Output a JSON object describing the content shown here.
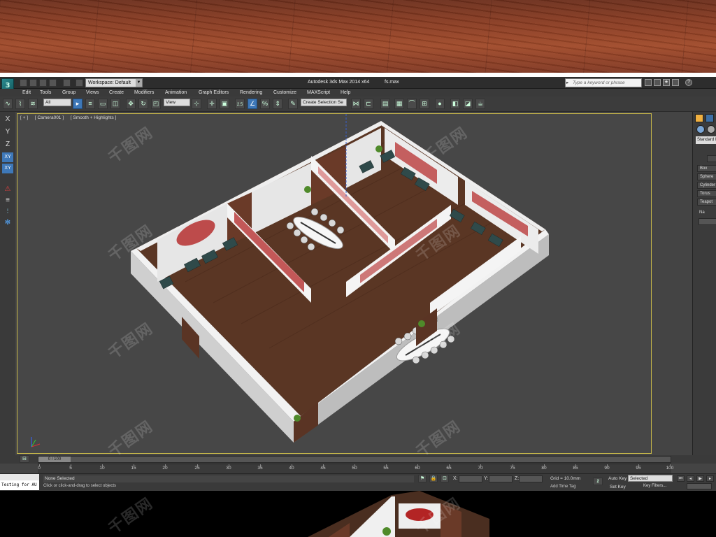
{
  "window": {
    "app_title": "Autodesk 3ds Max  2014 x64",
    "file_name": "fs.max",
    "workspace_label": "Workspace: Default",
    "search_placeholder": "Type a keyword or phrase",
    "help_label": "?"
  },
  "menu": [
    "Edit",
    "Tools",
    "Group",
    "Views",
    "Create",
    "Modifiers",
    "Animation",
    "Graph Editors",
    "Rendering",
    "Customize",
    "MAXScript",
    "Help"
  ],
  "toolbar": {
    "filter_select": "All",
    "ref_coord_select": "View",
    "selection_set_select": "Create Selection Se",
    "snap_label": "2.5",
    "percent_snap_label": "%"
  },
  "axis_constraints": [
    "X",
    "Y",
    "Z",
    "XY",
    "XY"
  ],
  "viewport": {
    "labels": [
      "[ + ]",
      "[ Camera001 ]",
      "[ Smooth + Highlights ]"
    ]
  },
  "command_panel": {
    "category_select": "Standard P",
    "object_buttons": [
      "Box",
      "Sphere",
      "Cylinder",
      "Torus",
      "Teapot"
    ],
    "section_label": "Na"
  },
  "timeline": {
    "slider_label": "0 / 100",
    "ticks": [
      "0",
      "5",
      "10",
      "15",
      "20",
      "25",
      "30",
      "35",
      "40",
      "45",
      "50",
      "55",
      "60",
      "65",
      "70",
      "75",
      "80",
      "85",
      "90",
      "95",
      "100"
    ]
  },
  "status": {
    "maxscript_text": "Testing for AU",
    "selection_text": "None Selected",
    "prompt_text": "Click or click-and-drag to select objects",
    "coord_x_label": "X:",
    "coord_y_label": "Y:",
    "coord_z_label": "Z:",
    "grid_text": "Grid = 10.0mm",
    "add_time_tag": "Add Time Tag",
    "auto_key_label": "Auto Key",
    "set_key_label": "Set Key",
    "auto_key_mode": "Selected",
    "key_filters_label": "Key Filters..."
  },
  "watermark": "千图网",
  "colors": {
    "viewport_bg": "#474747",
    "viewport_border": "#c9b94a",
    "active_tool": "#3e78b8",
    "floor": "#5a3624",
    "wall": "#d9d9d9",
    "red_decor": "#b32424"
  }
}
